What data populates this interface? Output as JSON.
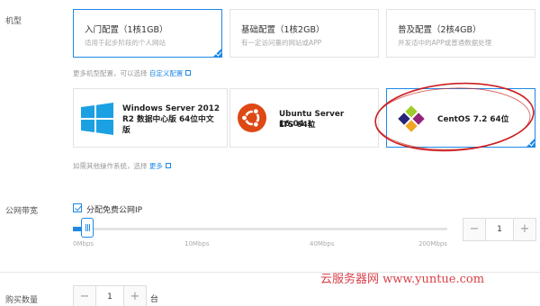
{
  "server_type": {
    "label": "机型",
    "configs": [
      {
        "title": "入门配置（1核1GB）",
        "desc": "适用于起步阶段的个人网站",
        "selected": true
      },
      {
        "title": "基础配置（1核2GB）",
        "desc": "有一定访问量的网站或APP",
        "selected": false
      },
      {
        "title": "普及配置（2核4GB）",
        "desc": "并发适中的APP或普通数据处理",
        "selected": false
      }
    ],
    "more_hint": "更多机型配置，可以选择",
    "more_link": "自定义配置"
  },
  "os": {
    "options": [
      {
        "name_line1": "Windows Server 2012",
        "name_line2": "R2 数据中心版 64位中文",
        "name_line3": "版",
        "icon": "windows-logo"
      },
      {
        "name_line1": "Ubuntu Server 16.04.1",
        "name_line2": "LTS 64位",
        "icon": "ubuntu-logo"
      },
      {
        "name_line1": "CentOS 7.2 64位",
        "icon": "centos-logo",
        "selected": true
      }
    ],
    "more_hint": "如需其他操作系统，选择",
    "more_link": "更多"
  },
  "bandwidth": {
    "label": "公网带宽",
    "checkbox_label": "分配免费公网IP",
    "checked": true,
    "ticks": [
      "0Mbps",
      "10Mbps",
      "40Mbps",
      "200Mbps"
    ],
    "value": "1",
    "minus": "−",
    "plus": "+"
  },
  "quantity": {
    "label": "购买数量",
    "value": "1",
    "unit": "台",
    "minus": "−",
    "plus": "+"
  },
  "watermark": "云服务器网 www.yuntue.com",
  "colors": {
    "accent": "#1e88e5",
    "annotation": "#cc1f1f"
  }
}
